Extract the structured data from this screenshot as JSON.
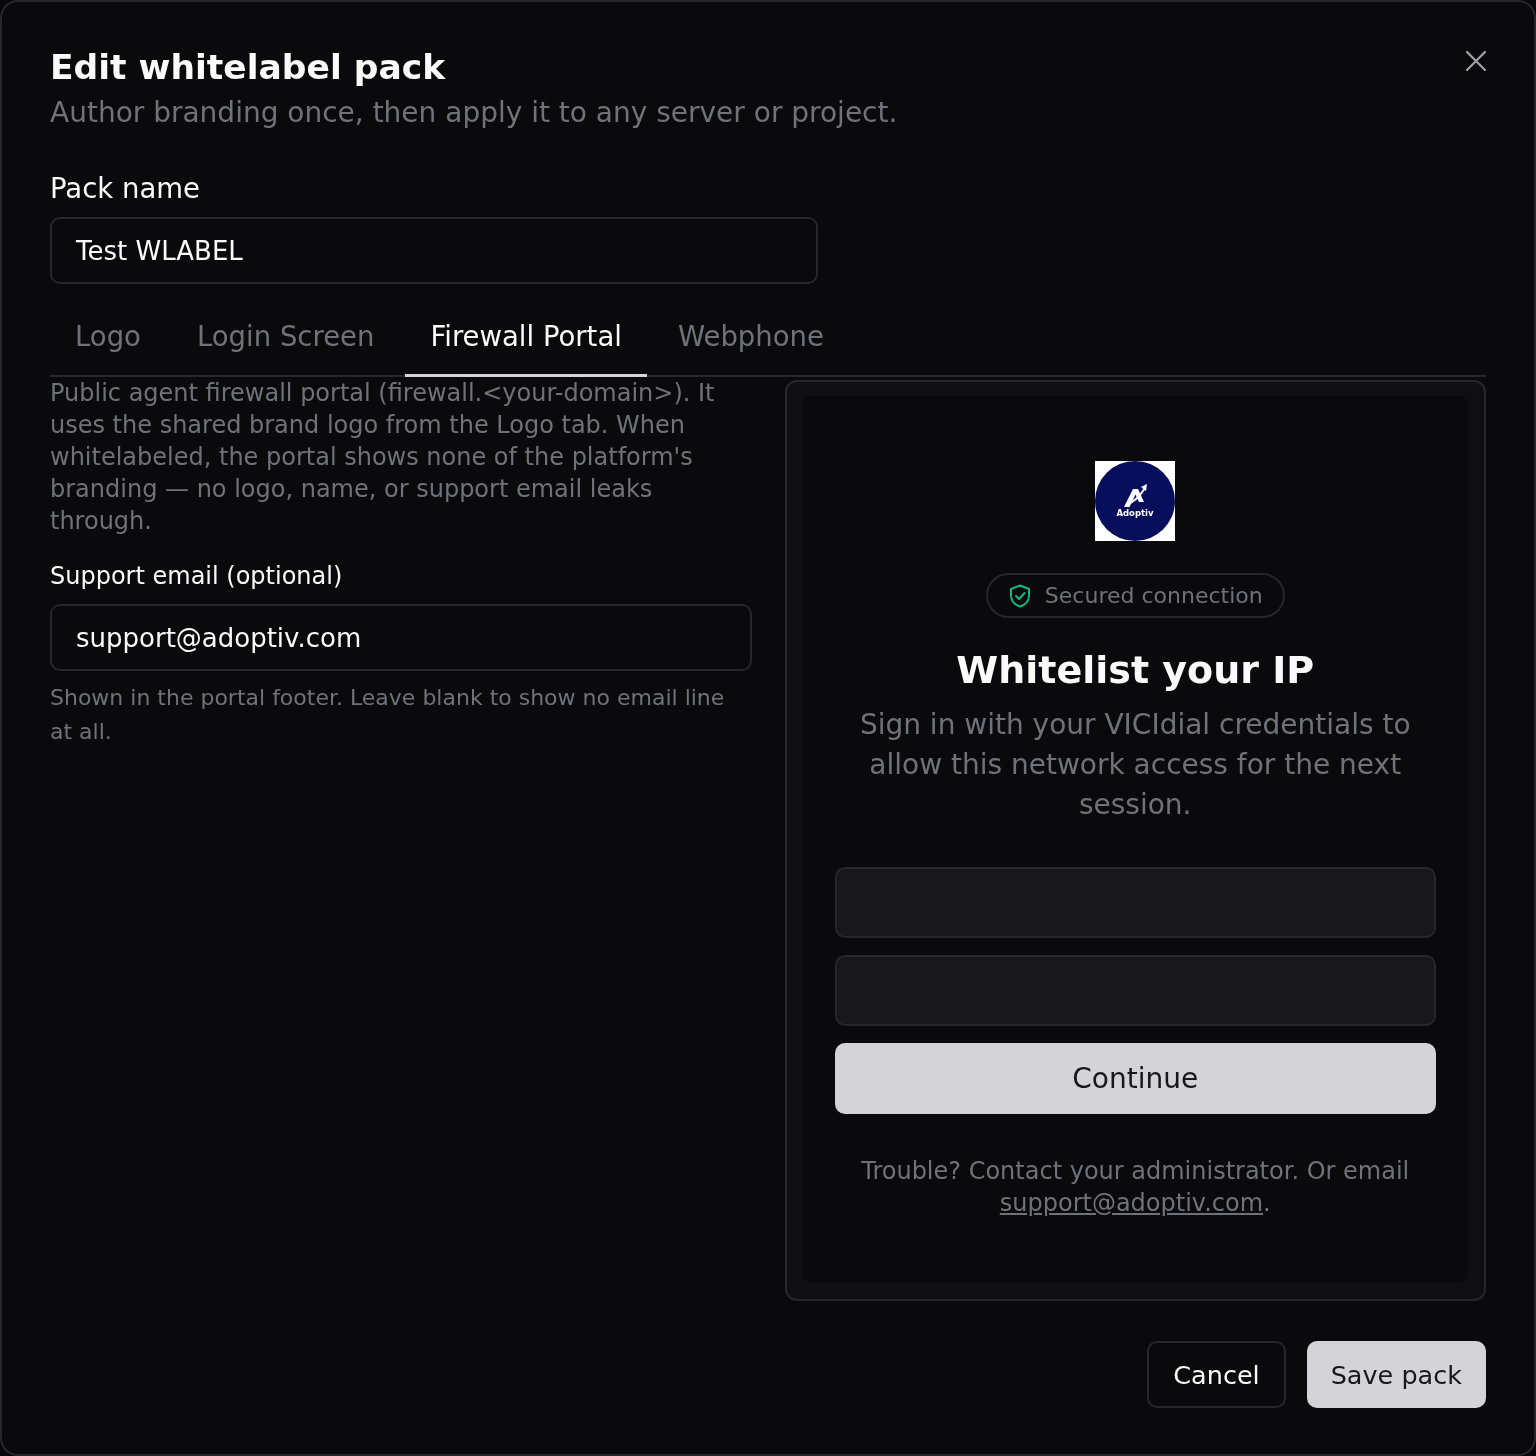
{
  "dialog": {
    "title": "Edit whitelabel pack",
    "subtitle": "Author branding once, then apply it to any server or project."
  },
  "pack_name": {
    "label": "Pack name",
    "value": "Test WLABEL"
  },
  "tabs": [
    {
      "label": "Logo",
      "selected": false
    },
    {
      "label": "Login Screen",
      "selected": false
    },
    {
      "label": "Firewall Portal",
      "selected": true
    },
    {
      "label": "Webphone",
      "selected": false
    }
  ],
  "firewall_portal": {
    "description": "Public agent firewall portal (firewall.<your-domain>). It uses the shared brand logo from the Logo tab. When whitelabeled, the portal shows none of the platform's branding — no logo, name, or support email leaks through.",
    "support_email": {
      "label": "Support email (optional)",
      "value": "support@adoptiv.com",
      "hint": "Shown in the portal footer. Leave blank to show no email line at all."
    }
  },
  "preview": {
    "logo_text": "Adoptiv",
    "badge": "Secured connection",
    "heading": "Whitelist your IP",
    "text": "Sign in with your VICIdial credentials to allow this network access for the next session.",
    "button": "Continue",
    "footer": {
      "text": "Trouble? Contact your administrator. Or email",
      "link": "support@adoptiv.com",
      "end": "."
    }
  },
  "actions": [
    {
      "label": "Cancel",
      "kind": "secondary"
    },
    {
      "label": "Save pack",
      "kind": "primary"
    }
  ]
}
